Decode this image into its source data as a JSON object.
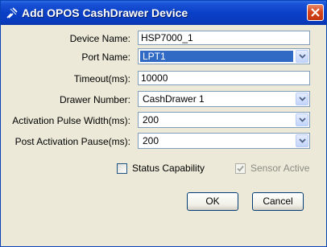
{
  "window": {
    "title": "Add OPOS CashDrawer Device",
    "icon": "cash-drawer-device-icon"
  },
  "form": {
    "device_name": {
      "label": "Device Name:",
      "value": "HSP7000_1"
    },
    "port_name": {
      "label": "Port Name:",
      "value": "LPT1"
    },
    "timeout": {
      "label": "Timeout(ms):",
      "value": "10000"
    },
    "drawer_number": {
      "label": "Drawer Number:",
      "value": "CashDrawer 1"
    },
    "activation_pulse_width": {
      "label": "Activation Pulse Width(ms):",
      "value": "200"
    },
    "post_activation_pause": {
      "label": "Post Activation Pause(ms):",
      "value": "200"
    }
  },
  "options": {
    "status_capability": {
      "label": "Status Capability",
      "checked": false,
      "enabled": true
    },
    "sensor_active": {
      "label": "Sensor Active",
      "checked": true,
      "enabled": false
    }
  },
  "buttons": {
    "ok": "OK",
    "cancel": "Cancel"
  },
  "colors": {
    "title_bar": "#0a3fc7",
    "close_button": "#d6451c",
    "selection": "#316ac5",
    "dialog_bg": "#ece9d8"
  }
}
